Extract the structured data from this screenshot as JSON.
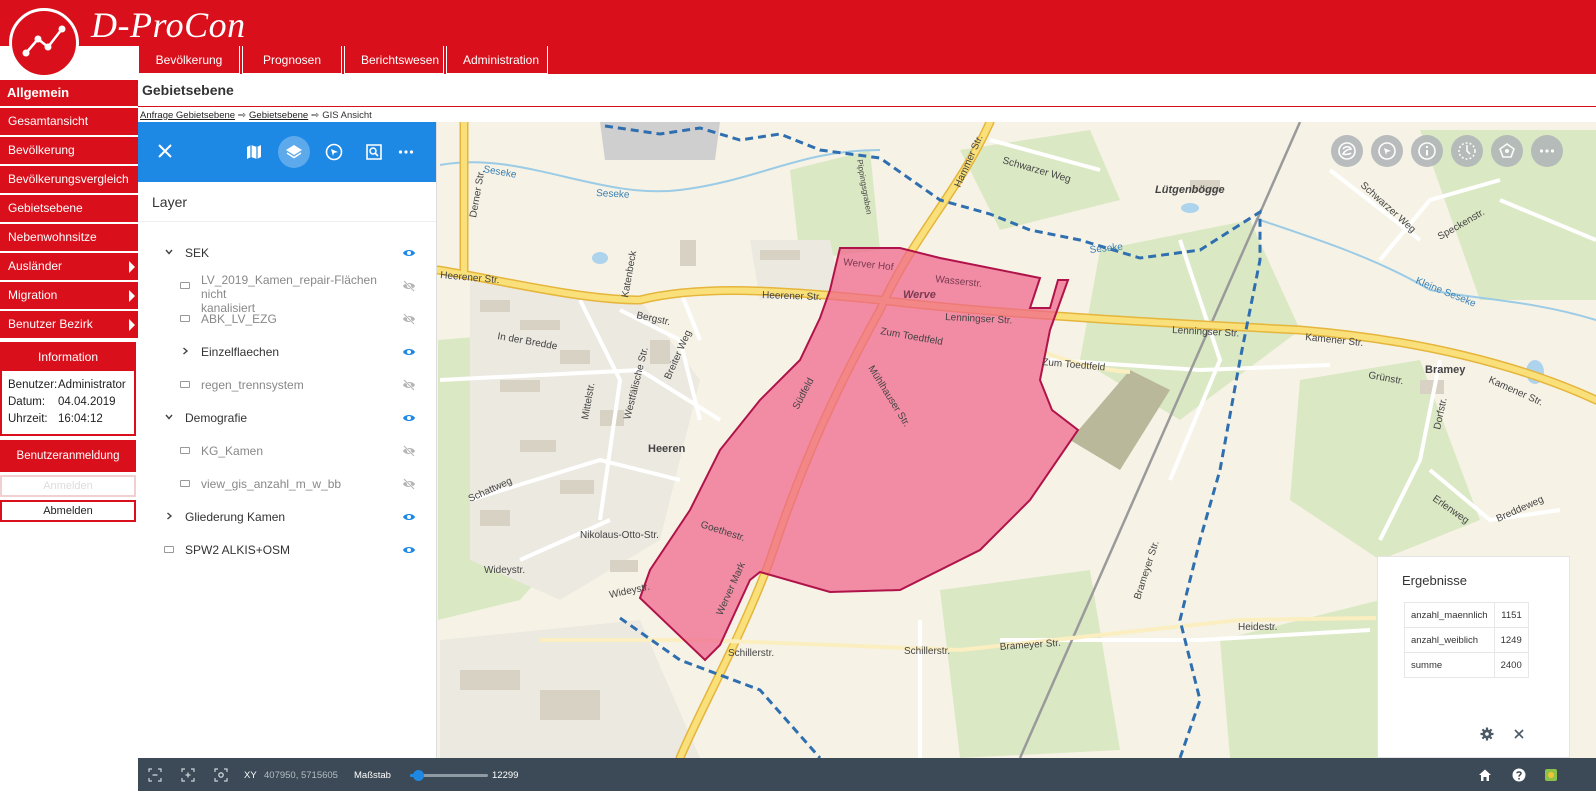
{
  "app": {
    "name": "D-ProCon"
  },
  "nav": {
    "items": [
      "Bevölkerung",
      "Prognosen",
      "Berichtswesen",
      "Administration"
    ]
  },
  "sidebar": {
    "title": "Allgemein",
    "items": [
      {
        "label": "Gesamtansicht",
        "submenu": false
      },
      {
        "label": "Bevölkerung",
        "submenu": false
      },
      {
        "label": "Bevölkerungsvergleich",
        "submenu": false
      },
      {
        "label": "Gebietsebene",
        "submenu": false
      },
      {
        "label": "Nebenwohnsitze",
        "submenu": false
      },
      {
        "label": "Ausländer",
        "submenu": true
      },
      {
        "label": "Migration",
        "submenu": true
      },
      {
        "label": "Benutzer Bezirk",
        "submenu": true
      }
    ],
    "info": {
      "title": "Information",
      "user_label": "Benutzer:",
      "user_value": "Administrator",
      "date_label": "Datum:",
      "date_value": "04.04.2019",
      "time_label": "Uhrzeit:",
      "time_value": "16:04:12"
    },
    "login": {
      "title": "Benutzeranmeldung",
      "login_label": "Anmelden",
      "logout_label": "Abmelden"
    }
  },
  "page": {
    "title": "Gebietsebene",
    "breadcrumb": [
      "Anfrage Gebietsebene",
      "Gebietsebene",
      "GIS Ansicht"
    ]
  },
  "layers": {
    "heading": "Layer",
    "items": [
      {
        "label": "SEK",
        "line2": "",
        "level": 0,
        "control": "chevron-down",
        "visible": true
      },
      {
        "label": "LV_2019_Kamen_repair-Flächen nicht",
        "line2": "kanalisiert",
        "level": 1,
        "control": "box",
        "visible": false
      },
      {
        "label": "ABK_LV_EZG",
        "line2": "",
        "level": 1,
        "control": "box",
        "visible": false
      },
      {
        "label": "Einzelflaechen",
        "line2": "",
        "level": 1,
        "control": "chevron-right",
        "visible": true
      },
      {
        "label": "regen_trennsystem",
        "line2": "",
        "level": 1,
        "control": "box",
        "visible": false
      },
      {
        "label": "Demografie",
        "line2": "",
        "level": 0,
        "control": "chevron-down",
        "visible": true
      },
      {
        "label": "KG_Kamen",
        "line2": "",
        "level": 1,
        "control": "box",
        "visible": false
      },
      {
        "label": "view_gis_anzahl_m_w_bb",
        "line2": "",
        "level": 1,
        "control": "box",
        "visible": false
      },
      {
        "label": "Gliederung Kamen",
        "line2": "",
        "level": 0,
        "control": "chevron-right",
        "visible": true
      },
      {
        "label": "SPW2 ALKIS+OSM",
        "line2": "",
        "level": 0,
        "control": "box",
        "visible": true
      }
    ]
  },
  "map": {
    "labels": {
      "luetgenboegge": "Lütgenbögge",
      "werve": "Werve",
      "heeren": "Heeren",
      "bramey": "Bramey",
      "heerener1": "Heerener Str.",
      "heerener2": "Heerener Str.",
      "lenningser1": "Lenningser Str.",
      "lenningser2": "Lenningser Str.",
      "kamener1": "Kamener Str.",
      "kamener2": "Kamener Str.",
      "hammer": "Hammer Str.",
      "schwarzer": "Schwarzer Weg",
      "schwarzer2": "Schwarzer Weg",
      "seseke1": "Seseke",
      "seseke2": "Seseke",
      "seseke3": "Seseke",
      "kleine_seseke": "Kleine Seseke",
      "speckenstr": "Speckenstr.",
      "zumtoedtfeld1": "Zum Toedtfeld",
      "zumtoedtfeld2": "Zum Toedtfeld",
      "muehlhauser": "Mühlhauser Str.",
      "suedfeld": "Südfeld",
      "goethestr": "Goethestr.",
      "schillerstr1": "Schillerstr.",
      "schillerstr2": "Schillerstr.",
      "brameyer": "Brameyer Str.",
      "brameyer2": "Brameyer Str.",
      "heidestr": "Heidestr.",
      "dorfstr": "Dorfstr.",
      "erlenweg": "Erlenweg",
      "breddeweg": "Breddeweg",
      "gruenstr": "Grünstr.",
      "inderbredde": "In der Bredde",
      "bergstr": "Bergstr.",
      "schattweg": "Schattweg",
      "wideystr": "Wideystr.",
      "nikolaus": "Nikolaus-Otto-Str.",
      "derner": "Derner Str.",
      "wasserstr": "Wasserstr.",
      "wervethof": "Werver Hof",
      "mittelstr": "Mittelstr.",
      "westf": "Westfälische Str.",
      "breiterweg": "Breiter Weg",
      "katenbeck": "Katenbeck",
      "pipping": "Pippingsgraben",
      "wideystr2": "Wideystr.",
      "werver_mark": "Werver Mark"
    },
    "colors": {
      "selection_fill": "#f0648c",
      "selection_stroke": "#b0134a",
      "border_blue": "#2f6fb0",
      "road_yellow": "#f7d75a"
    }
  },
  "results": {
    "title": "Ergebnisse",
    "rows": [
      {
        "name": "anzahl_maennlich",
        "value": "1151"
      },
      {
        "name": "anzahl_weiblich",
        "value": "1249"
      },
      {
        "name": "summe",
        "value": "2400"
      }
    ]
  },
  "statusbar": {
    "xy_label": "XY",
    "xy_value": "407950, 5715605",
    "scale_label": "Maßstab",
    "scale_value": "12299",
    "scale_slider_fraction": 0.1
  }
}
